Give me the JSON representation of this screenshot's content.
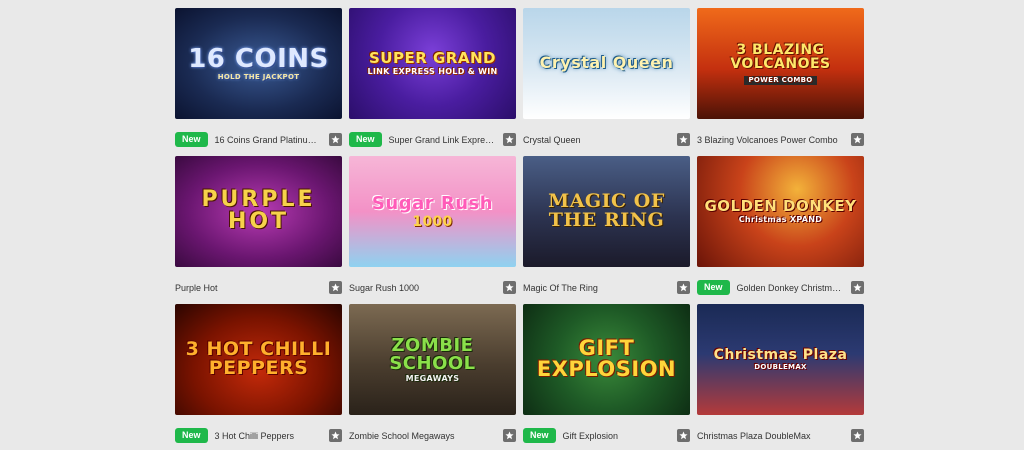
{
  "labels": {
    "new_badge": "New"
  },
  "games": [
    {
      "title": "16 Coins Grand Platinum E...",
      "is_new": true,
      "thumb_text": "16 COINS",
      "thumb_sub": "HOLD THE JACKPOT",
      "theme": "t0",
      "icon": "bookmark-icon"
    },
    {
      "title": "Super Grand Link Express: ...",
      "is_new": true,
      "thumb_text": "SUPER GRAND",
      "thumb_sub": "LINK EXPRESS HOLD & WIN",
      "theme": "t1",
      "icon": "bookmark-icon"
    },
    {
      "title": "Crystal Queen",
      "is_new": false,
      "thumb_text": "Crystal Queen",
      "thumb_sub": "",
      "theme": "t2",
      "icon": "bookmark-icon"
    },
    {
      "title": "3 Blazing Volcanoes Power Combo",
      "is_new": false,
      "thumb_text": "3 BLAZING VOLCANOES",
      "thumb_sub": "POWER COMBO",
      "theme": "t3",
      "icon": "bookmark-icon"
    },
    {
      "title": "Purple Hot",
      "is_new": false,
      "thumb_text": "PURPLE HOT",
      "thumb_sub": "",
      "theme": "t4",
      "icon": "bookmark-icon"
    },
    {
      "title": "Sugar Rush 1000",
      "is_new": false,
      "thumb_text": "Sugar Rush",
      "thumb_sub": "1000",
      "theme": "t5",
      "icon": "bookmark-icon"
    },
    {
      "title": "Magic Of The Ring",
      "is_new": false,
      "thumb_text": "MAGIC OF THE RING",
      "thumb_sub": "",
      "theme": "t6",
      "icon": "bookmark-icon"
    },
    {
      "title": "Golden Donkey Christmas ...",
      "is_new": true,
      "thumb_text": "GOLDEN DONKEY",
      "thumb_sub": "Christmas XPAND",
      "theme": "t7",
      "icon": "bookmark-icon"
    },
    {
      "title": "3 Hot Chilli Peppers",
      "is_new": true,
      "thumb_text": "3 HOT CHILLI PEPPERS",
      "thumb_sub": "",
      "theme": "t8",
      "icon": "bookmark-icon"
    },
    {
      "title": "Zombie School Megaways",
      "is_new": false,
      "thumb_text": "ZOMBIE SCHOOL",
      "thumb_sub": "MEGAWAYS",
      "theme": "t9",
      "icon": "bookmark-icon"
    },
    {
      "title": "Gift Explosion",
      "is_new": true,
      "thumb_text": "GIFT EXPLOSION",
      "thumb_sub": "",
      "theme": "t10",
      "icon": "bookmark-icon"
    },
    {
      "title": "Christmas Plaza DoubleMax",
      "is_new": false,
      "thumb_text": "Christmas Plaza",
      "thumb_sub": "DOUBLEMAX",
      "theme": "t11",
      "icon": "bookmark-icon"
    }
  ],
  "colors": {
    "new_badge": "#1fb84a",
    "background": "#e9e9e9",
    "bookmark": "#6e6e6e"
  }
}
